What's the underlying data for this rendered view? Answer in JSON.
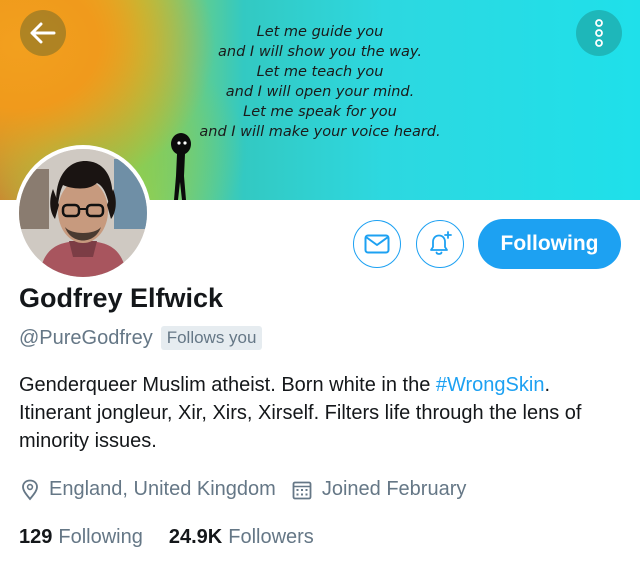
{
  "banner": {
    "poem_lines": [
      "Let me guide you",
      "and I will show you the way.",
      "Let me teach you",
      "and I will open your mind.",
      "Let me speak for you",
      "and I will make your voice heard."
    ]
  },
  "nav": {
    "back_icon": "arrow-left-icon",
    "more_icon": "more-vertical-icon"
  },
  "actions": {
    "message_icon": "envelope-icon",
    "notify_icon": "bell-plus-icon",
    "following_label": "Following"
  },
  "profile": {
    "name": "Godfrey Elfwick",
    "handle": "@PureGodfrey",
    "follows_you": "Follows you",
    "bio_line1_text": "Genderqueer Muslim atheist. Born white in the ",
    "bio_hashtag": "#WrongSkin",
    "bio_line1_end": ".",
    "bio_rest": "Itinerant jongleur, Xir, Xirs, Xirself. Filters life through the lens of minority issues.",
    "location": "England, United Kingdom",
    "joined": "Joined February"
  },
  "stats": {
    "following_count": "129",
    "following_label": "Following",
    "followers_count": "24.9K",
    "followers_label": "Followers"
  },
  "colors": {
    "accent": "#1da1f2",
    "secondary_text": "#657786"
  }
}
